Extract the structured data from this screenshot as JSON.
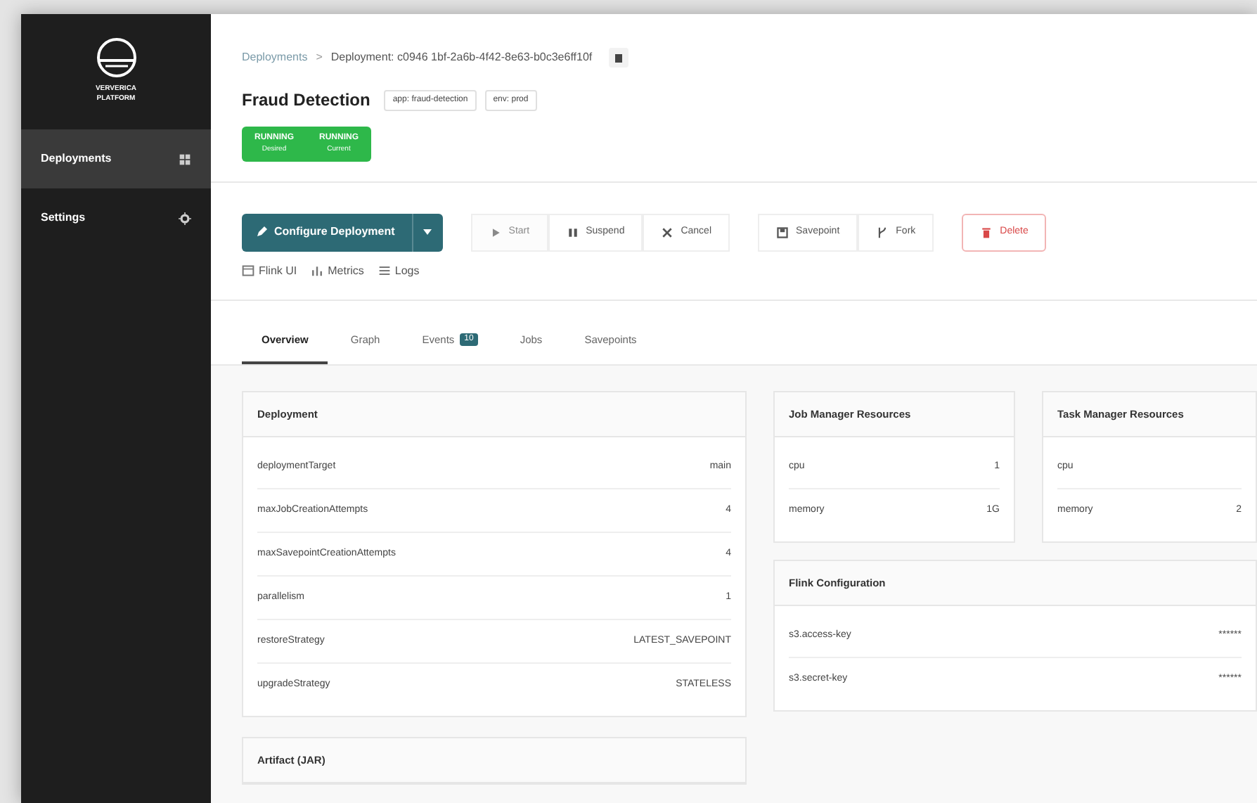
{
  "sidebar": {
    "brand": [
      "VERVERICA",
      "PLATFORM"
    ],
    "items": [
      {
        "label": "Deployments",
        "selected": true
      },
      {
        "label": "Settings",
        "selected": false
      }
    ]
  },
  "breadcrumb": {
    "items": [
      "Deployments",
      "Deployment: c0946 1bf-2a6b-4f42-8e63-b0c3e6ff10f"
    ],
    "separator": ">"
  },
  "title": "Fraud Detection",
  "labels": [
    "app: fraud-detection",
    "env: prod"
  ],
  "status": [
    {
      "state": "RUNNING",
      "caption": "Desired"
    },
    {
      "state": "RUNNING",
      "caption": "Current"
    }
  ],
  "primary_action": "Configure Deployment",
  "actions": [
    [
      {
        "label": "Start",
        "disabled": true
      },
      {
        "label": "Suspend",
        "disabled": false
      },
      {
        "label": "Cancel",
        "disabled": false
      }
    ],
    [
      {
        "label": "Savepoint",
        "disabled": false
      },
      {
        "label": "Fork",
        "disabled": false
      }
    ],
    [
      {
        "label": "Delete",
        "disabled": false,
        "kind": "danger"
      }
    ]
  ],
  "links": [
    {
      "label": "Flink UI"
    },
    {
      "label": "Metrics"
    },
    {
      "label": "Logs"
    }
  ],
  "tabs": [
    {
      "label": "Overview",
      "selected": true
    },
    {
      "label": "Graph",
      "selected": false
    },
    {
      "label": "Events",
      "selected": false,
      "badge": "10"
    },
    {
      "label": "Jobs",
      "selected": false
    },
    {
      "label": "Savepoints",
      "selected": false
    }
  ],
  "deployment": {
    "title": "Deployment",
    "rows": [
      [
        "deploymentTarget",
        "main"
      ],
      [
        "maxJobCreationAttempts",
        "4"
      ],
      [
        "maxSavepointCreationAttempts",
        "4"
      ],
      [
        "parallelism",
        "1"
      ],
      [
        "restoreStrategy",
        "LATEST_SAVEPOINT"
      ],
      [
        "upgradeStrategy",
        "STATELESS"
      ]
    ]
  },
  "artifact": {
    "title": "Artifact (JAR)"
  },
  "job_manager": {
    "title": "Job Manager Resources",
    "rows": [
      [
        "cpu",
        "1"
      ],
      [
        "memory",
        "1G"
      ]
    ]
  },
  "task_manager": {
    "title": "Task Manager Resources",
    "rows": [
      [
        "cpu"
      ],
      [
        "memory",
        "2"
      ]
    ]
  },
  "flink_configuration": {
    "title": "Flink Configuration",
    "rows": [
      [
        "s3.access-key",
        "******"
      ],
      [
        "s3.secret-key",
        "******"
      ]
    ]
  }
}
